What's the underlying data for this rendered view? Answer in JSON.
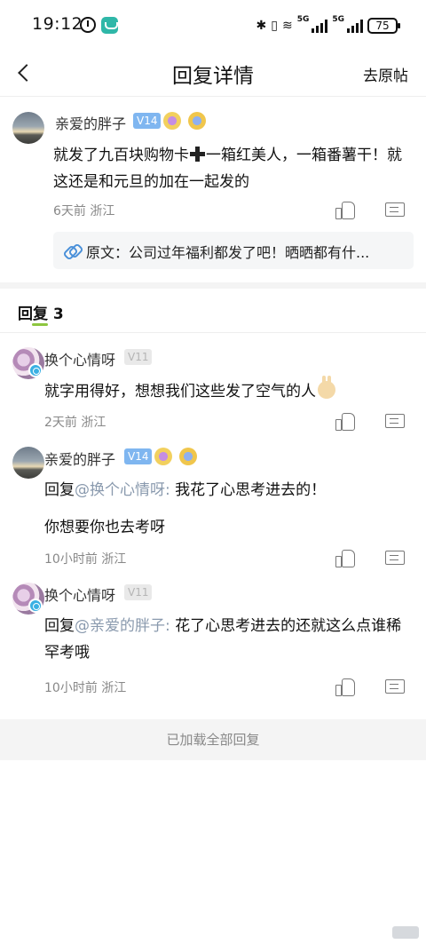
{
  "status_bar": {
    "time": "19:12",
    "network_1": "5G",
    "network_2": "5G",
    "battery": "75"
  },
  "header": {
    "title": "回复详情",
    "action": "去原帖"
  },
  "main_comment": {
    "user": "亲爱的胖子",
    "level": "V14",
    "text_part1": "就发了九百块购物卡",
    "text_part2": "一箱红美人，一箱番薯干！就这还是和元旦的加在一起发的",
    "time": "6天前",
    "location": "浙江",
    "quote": "原文：公司过年福利都发了吧！晒晒都有什..."
  },
  "replies_header": {
    "label": "回复",
    "count": "3"
  },
  "replies": [
    {
      "user": "换个心情呀",
      "level": "V11",
      "text": "就字用得好，想想我们这些发了空气的人",
      "time": "2天前",
      "location": "浙江"
    },
    {
      "user": "亲爱的胖子",
      "level": "V14",
      "prefix": "回复",
      "mention": "@换个心情呀:",
      "text": " 我花了心思考进去的！",
      "text2": "你想要你也去考呀",
      "time": "10小时前",
      "location": "浙江"
    },
    {
      "user": "换个心情呀",
      "level": "V11",
      "prefix": "回复",
      "mention": "@亲爱的胖子:",
      "text": " 花了心思考进去的还就这么点谁稀罕考哦",
      "time": "10小时前",
      "location": "浙江"
    }
  ],
  "footer": {
    "text": "已加载全部回复"
  }
}
